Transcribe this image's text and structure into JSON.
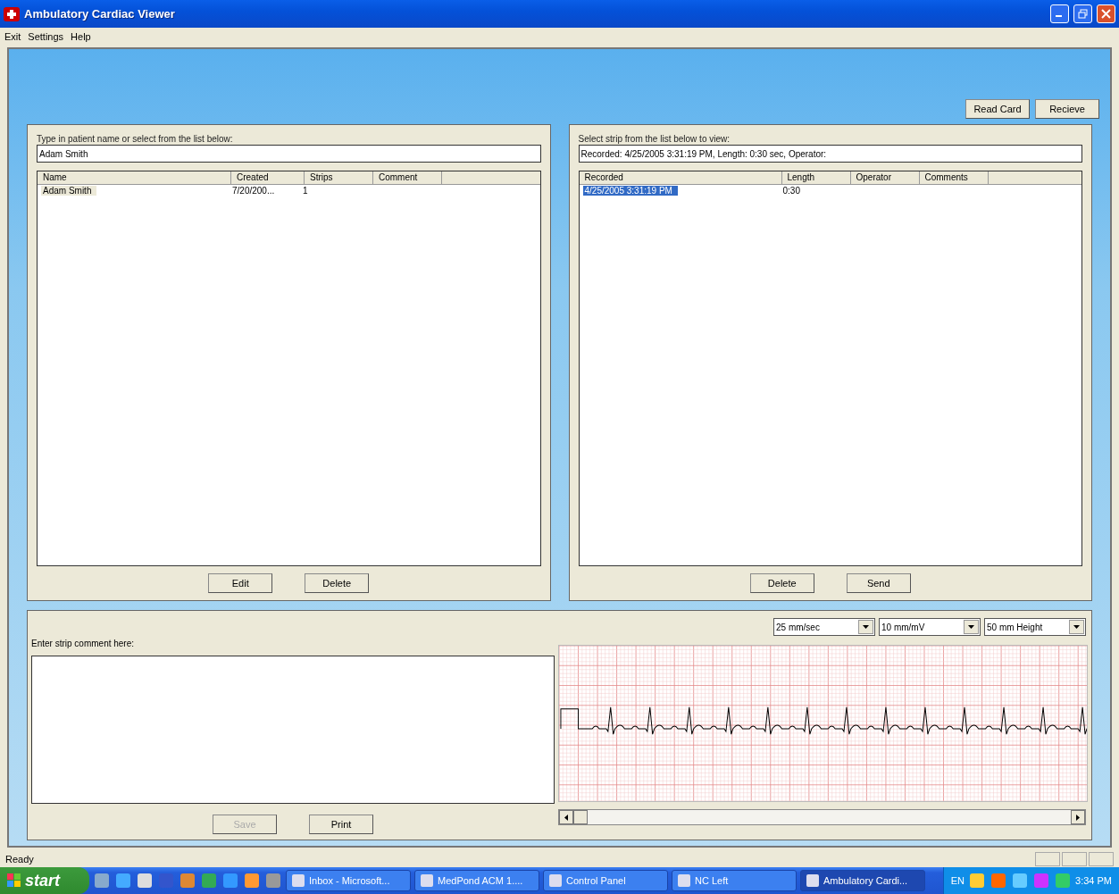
{
  "window": {
    "title": "Ambulatory Cardiac Viewer"
  },
  "menu": [
    "Exit",
    "Settings",
    "Help"
  ],
  "top_buttons": [
    {
      "label": "Read Card"
    },
    {
      "label": "Recieve"
    }
  ],
  "patients": {
    "prompt": "Type in patient name or select from the list below:",
    "value": "Adam Smith",
    "focused": false,
    "columns": [
      "Name",
      "Created",
      "Strips",
      "Comment"
    ],
    "rows": [
      {
        "cells": [
          "Adam Smith",
          "7/20/200...",
          "1",
          ""
        ],
        "selected": true
      }
    ],
    "buttons": [
      {
        "label": "Edit",
        "disabled": false
      },
      {
        "label": "Delete",
        "disabled": false
      }
    ]
  },
  "strips": {
    "prompt": "Select strip from the list below to view:",
    "value": "Recorded: 4/25/2005 3:31:19 PM, Length: 0:30 sec, Operator:",
    "focused": true,
    "columns": [
      "Recorded",
      "Length",
      "Operator",
      "Comments"
    ],
    "rows": [
      {
        "cells": [
          "4/25/2005 3:31:19 PM",
          "0:30",
          "",
          ""
        ],
        "selected": true
      }
    ],
    "buttons": [
      {
        "label": "Delete",
        "disabled": false
      },
      {
        "label": "Send",
        "disabled": false
      }
    ]
  },
  "comment": {
    "label": "Enter strip comment here:",
    "buttons": [
      {
        "label": "Save",
        "disabled": true
      },
      {
        "label": "Print",
        "disabled": false
      }
    ]
  },
  "ecg": {
    "dropdowns": [
      "25 mm/sec",
      "10 mm/mV",
      "50 mm Height"
    ]
  },
  "status_bar": {
    "text": "Ready"
  },
  "taskbar": {
    "start": "start",
    "tasks": [
      {
        "label": "Inbox - Microsoft...",
        "selected": false
      },
      {
        "label": "MedPond ACM 1....",
        "selected": false
      },
      {
        "label": "Control Panel",
        "selected": false
      },
      {
        "label": "NC Left",
        "selected": false
      },
      {
        "label": "Ambulatory Cardi...",
        "selected": true
      }
    ],
    "language": "EN",
    "clock": "3:34 PM"
  }
}
